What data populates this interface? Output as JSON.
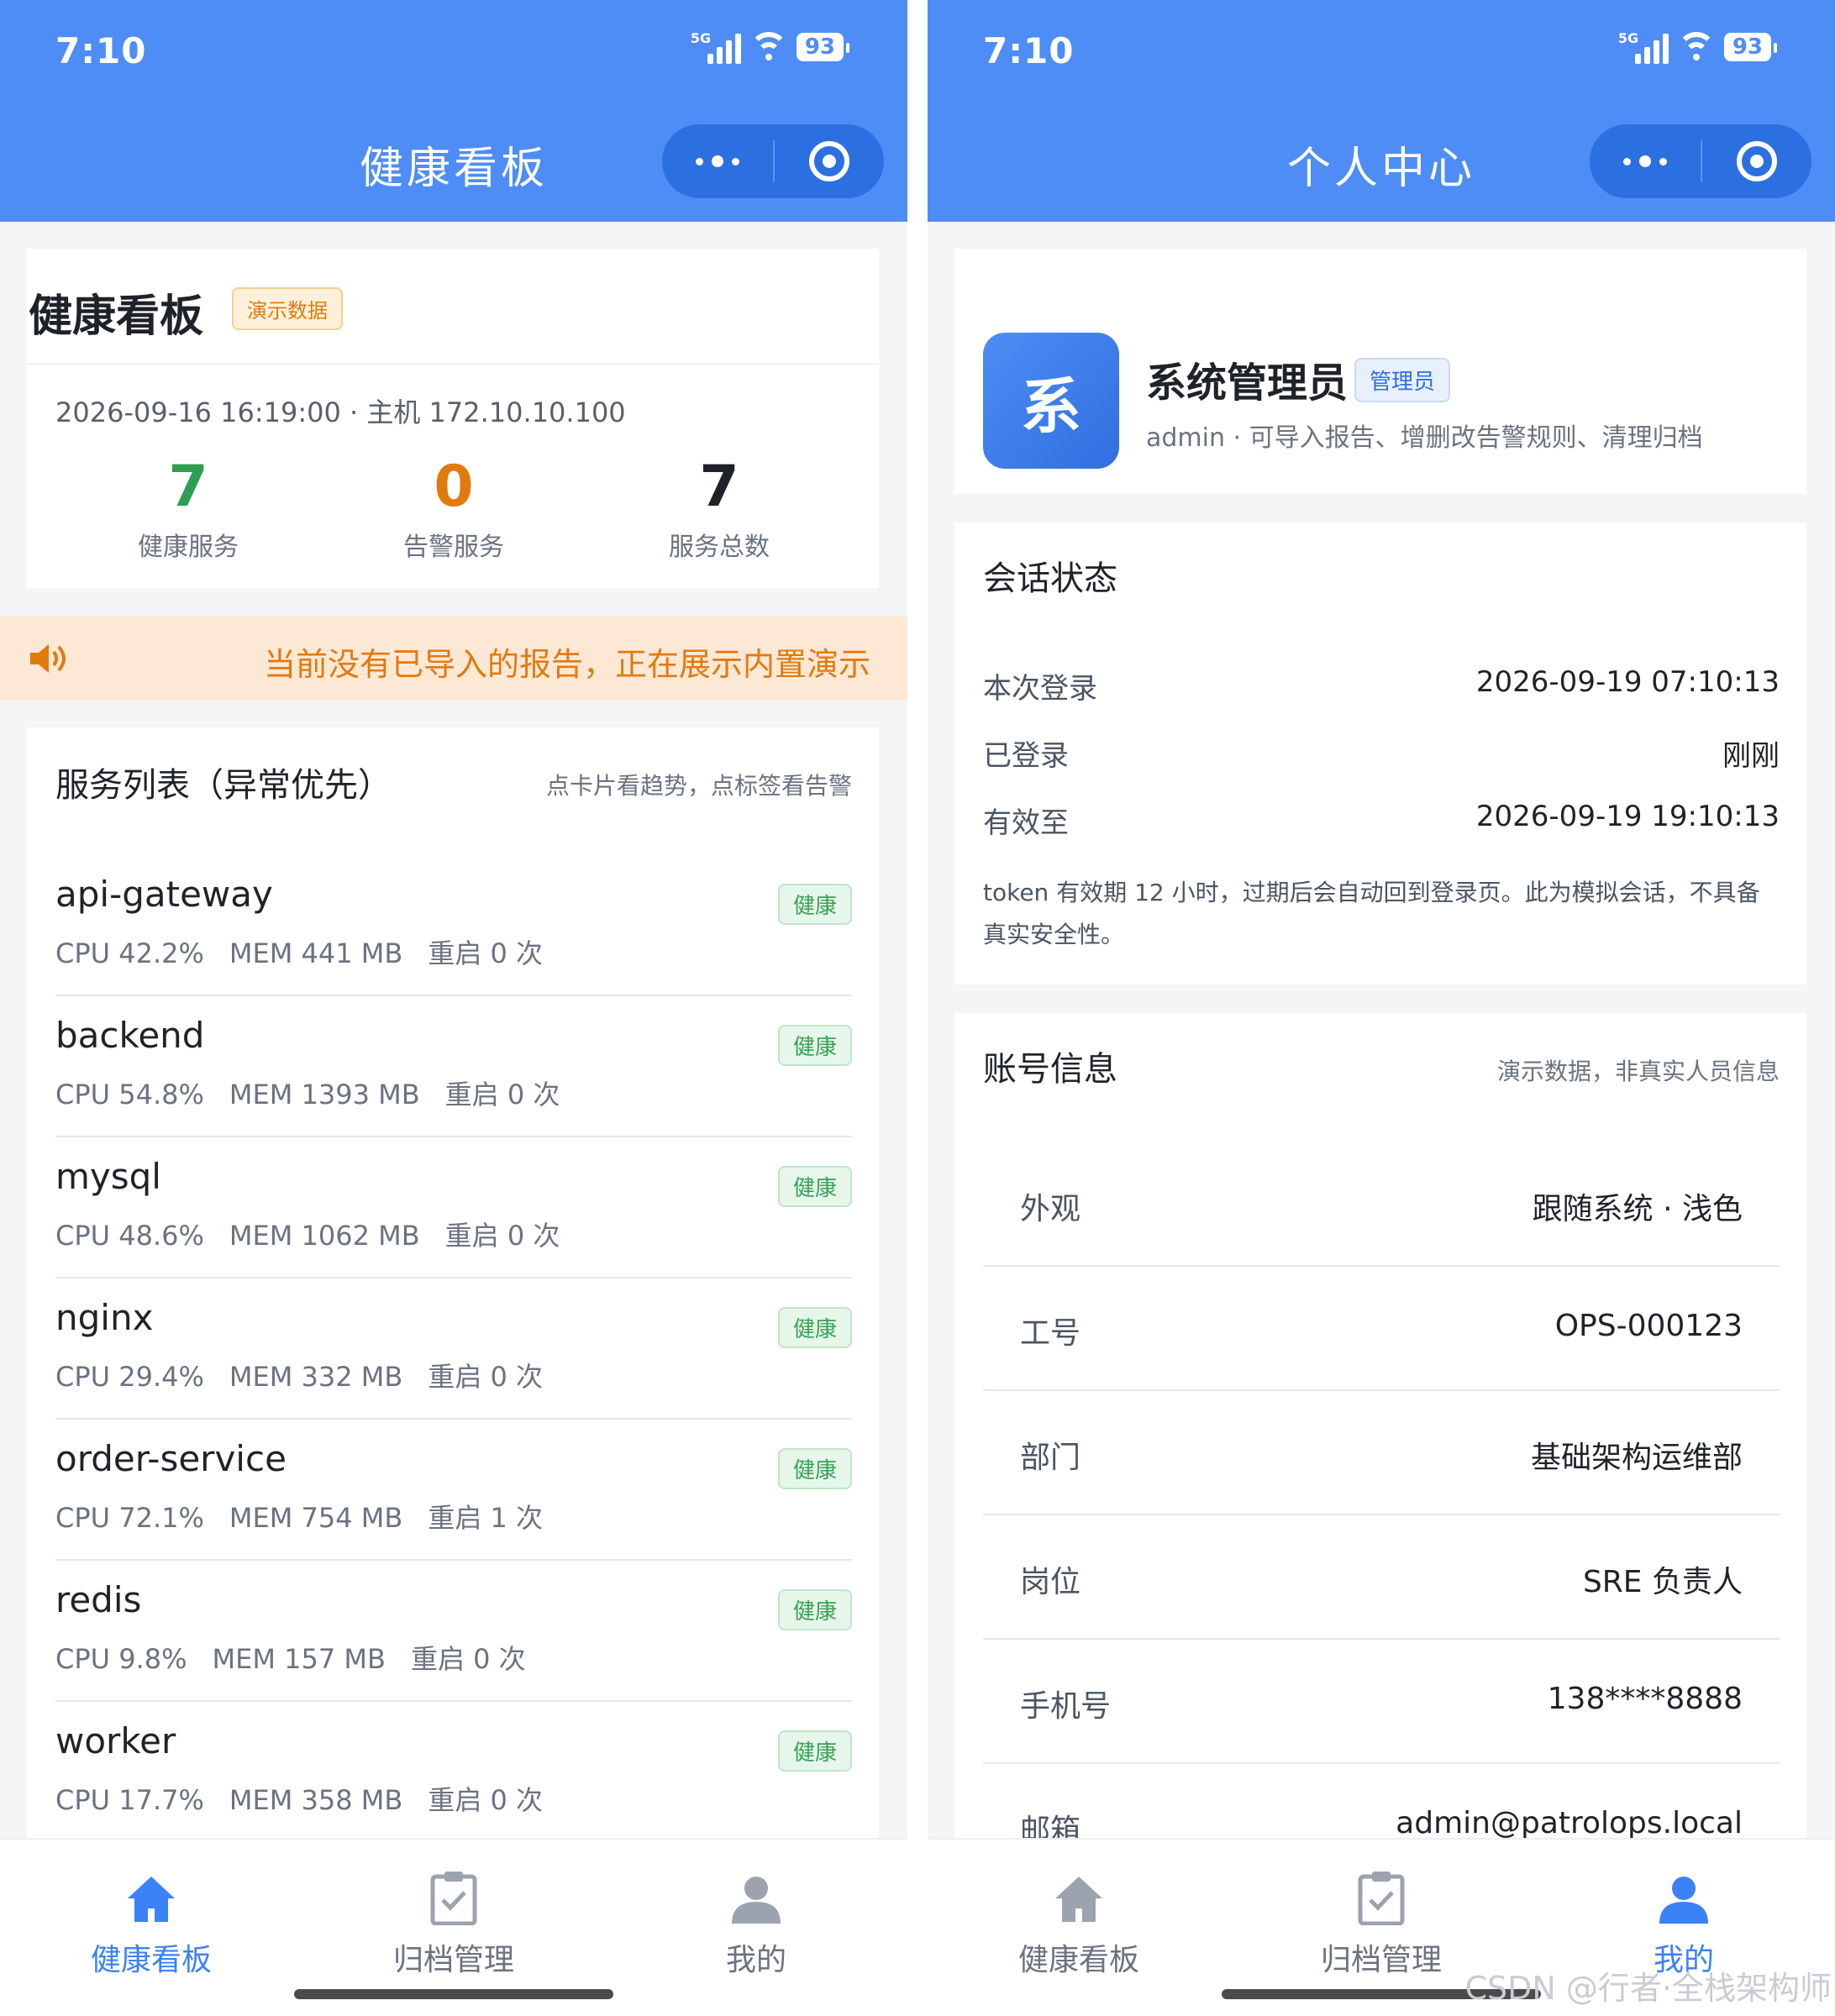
{
  "status": {
    "time": "7:10",
    "network": "5G",
    "battery": "93"
  },
  "left": {
    "header_title": "健康看板",
    "summary": {
      "title": "健康看板",
      "tag": "演示数据",
      "meta": "2026-09-16 16:19:00 · 主机 172.10.10.100",
      "stats": [
        {
          "value": "7",
          "label": "健康服务",
          "color": "#2e9e52"
        },
        {
          "value": "0",
          "label": "告警服务",
          "color": "#e07a0c"
        },
        {
          "value": "7",
          "label": "服务总数",
          "color": "#1f2329"
        }
      ]
    },
    "notice": "当前没有已导入的报告，正在展示内置演示",
    "list": {
      "title": "服务列表（异常优先）",
      "hint": "点卡片看趋势，点标签看告警",
      "services": [
        {
          "name": "api-gateway",
          "cpu": "CPU 42.2%",
          "mem": "MEM 441 MB",
          "restart": "重启 0 次",
          "status": "健康"
        },
        {
          "name": "backend",
          "cpu": "CPU 54.8%",
          "mem": "MEM 1393 MB",
          "restart": "重启 0 次",
          "status": "健康"
        },
        {
          "name": "mysql",
          "cpu": "CPU 48.6%",
          "mem": "MEM 1062 MB",
          "restart": "重启 0 次",
          "status": "健康"
        },
        {
          "name": "nginx",
          "cpu": "CPU 29.4%",
          "mem": "MEM 332 MB",
          "restart": "重启 0 次",
          "status": "健康"
        },
        {
          "name": "order-service",
          "cpu": "CPU 72.1%",
          "mem": "MEM 754 MB",
          "restart": "重启 1 次",
          "status": "健康"
        },
        {
          "name": "redis",
          "cpu": "CPU 9.8%",
          "mem": "MEM 157 MB",
          "restart": "重启 0 次",
          "status": "健康"
        },
        {
          "name": "worker",
          "cpu": "CPU 17.7%",
          "mem": "MEM 358 MB",
          "restart": "重启 0 次",
          "status": "健康"
        }
      ]
    }
  },
  "right": {
    "header_title": "个人中心",
    "profile": {
      "avatar_char": "系",
      "name": "系统管理员",
      "role": "管理员",
      "desc": "admin · 可导入报告、增删改告警规则、清理归档"
    },
    "session": {
      "title": "会话状态",
      "rows": [
        {
          "key": "本次登录",
          "value": "2026-09-19 07:10:13"
        },
        {
          "key": "已登录",
          "value": "刚刚"
        },
        {
          "key": "有效至",
          "value": "2026-09-19 19:10:13"
        }
      ],
      "note": "token 有效期 12 小时，过期后会自动回到登录页。此为模拟会话，不具备真实安全性。"
    },
    "account": {
      "title": "账号信息",
      "hint": "演示数据，非真实人员信息",
      "rows": [
        {
          "key": "外观",
          "value": "跟随系统 · 浅色"
        },
        {
          "key": "工号",
          "value": "OPS-000123"
        },
        {
          "key": "部门",
          "value": "基础架构运维部"
        },
        {
          "key": "岗位",
          "value": "SRE 负责人"
        },
        {
          "key": "手机号",
          "value": "138****8888"
        },
        {
          "key": "邮箱",
          "value": "admin@patrolops.local"
        }
      ]
    }
  },
  "tabs": [
    {
      "label": "健康看板",
      "icon": "home-icon"
    },
    {
      "label": "归档管理",
      "icon": "clipboard-check-icon"
    },
    {
      "label": "我的",
      "icon": "user-icon"
    }
  ],
  "colors": {
    "primary": "#4e8df5",
    "accent": "#3b82f6",
    "warning": "#e07a0c",
    "healthy": "#2e9e52"
  },
  "watermark": "CSDN @行者·全栈架构师"
}
